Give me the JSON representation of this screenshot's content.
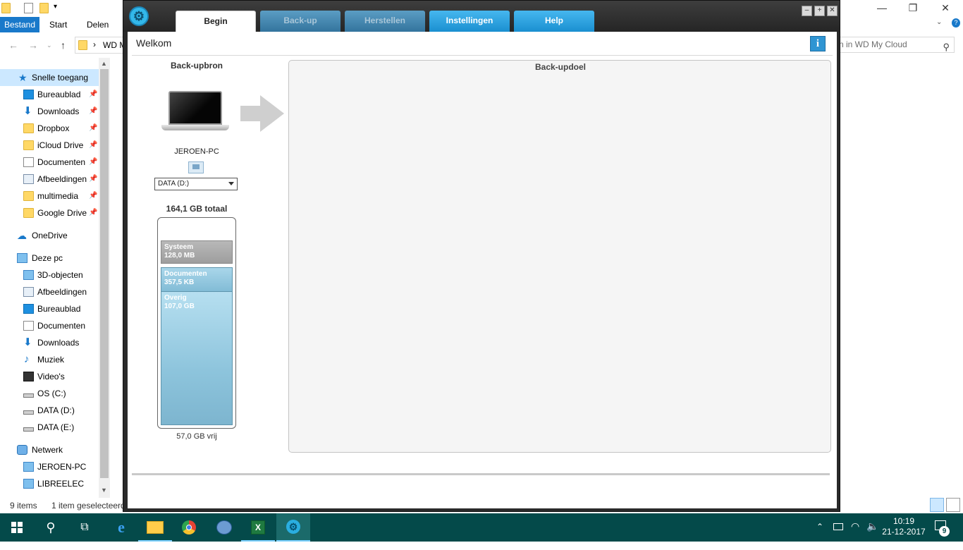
{
  "explorer": {
    "ribbon_tabs": [
      "Bestand",
      "Start",
      "Delen"
    ],
    "address_text": "WD M",
    "address_sep": "›",
    "search_placeholder": "n in WD My Cloud",
    "nav": {
      "quick_access": "Snelle toegang",
      "quick_items": [
        "Bureaublad",
        "Downloads",
        "Dropbox",
        "iCloud Drive",
        "Documenten",
        "Afbeeldingen",
        "multimedia",
        "Google Drive"
      ],
      "onedrive": "OneDrive",
      "this_pc": "Deze pc",
      "pc_items": [
        "3D-objecten",
        "Afbeeldingen",
        "Bureaublad",
        "Documenten",
        "Downloads",
        "Muziek",
        "Video's",
        "OS (C:)",
        "DATA (D:)",
        "DATA (E:)"
      ],
      "network": "Netwerk",
      "network_items": [
        "JEROEN-PC",
        "LIBREELEC"
      ]
    },
    "status": {
      "items": "9 items",
      "selected": "1 item geselecteerd"
    }
  },
  "app": {
    "tabs": [
      "Begin",
      "Back-up",
      "Herstellen",
      "Instellingen",
      "Help"
    ],
    "welcome": "Welkom",
    "info_icon": "i",
    "source": {
      "label": "Back-upbron",
      "pc_name": "JEROEN-PC",
      "drive": "DATA (D:)",
      "total": "164,1 GB totaal",
      "free": "57,0 GB vrij",
      "segments": [
        {
          "name": "Systeem",
          "size": "128,0 MB"
        },
        {
          "name": "Documenten",
          "size": "357,5 KB"
        },
        {
          "name": "Overig",
          "size": "107,0 GB"
        }
      ]
    },
    "destination": {
      "label": "Back-updoel"
    }
  },
  "taskbar": {
    "time": "10:19",
    "date": "21-12-2017",
    "notifications": "9"
  }
}
